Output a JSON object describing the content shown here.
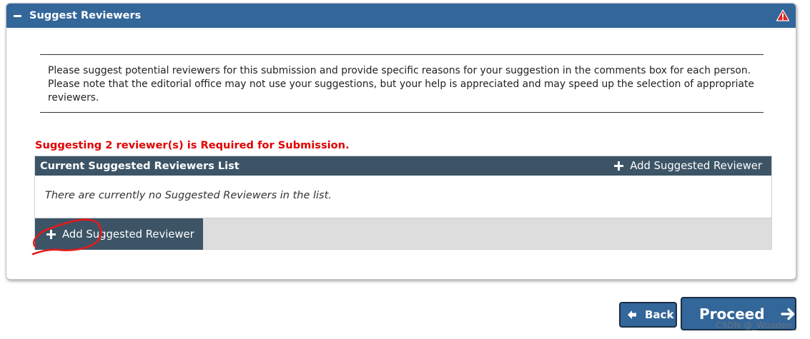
{
  "panel": {
    "title": "Suggest Reviewers",
    "collapse_icon": "minus-icon",
    "alert_icon": "warning-triangle-icon",
    "alert_color": "#e02020",
    "header_color": "#336699"
  },
  "instructions": {
    "text": "Please suggest potential reviewers for this submission and provide specific reasons for your suggestion in the comments box for each person. Please note that the editorial office may not use your suggestions, but your help is appreciated and may speed up the selection of appropriate reviewers."
  },
  "requirement": {
    "text": "Suggesting 2 reviewer(s) is Required for Submission.",
    "color": "#e00000"
  },
  "reviewer_list": {
    "title": "Current Suggested Reviewers List",
    "add_label": "Add Suggested Reviewer",
    "empty_message": "There are currently no Suggested Reviewers in the list.",
    "footer_add_label": "Add Suggested Reviewer",
    "header_color": "#3c5466"
  },
  "buttons": {
    "back_label": "Back",
    "proceed_label": "Proceed"
  },
  "watermark": "CSDN @_Wooden_"
}
